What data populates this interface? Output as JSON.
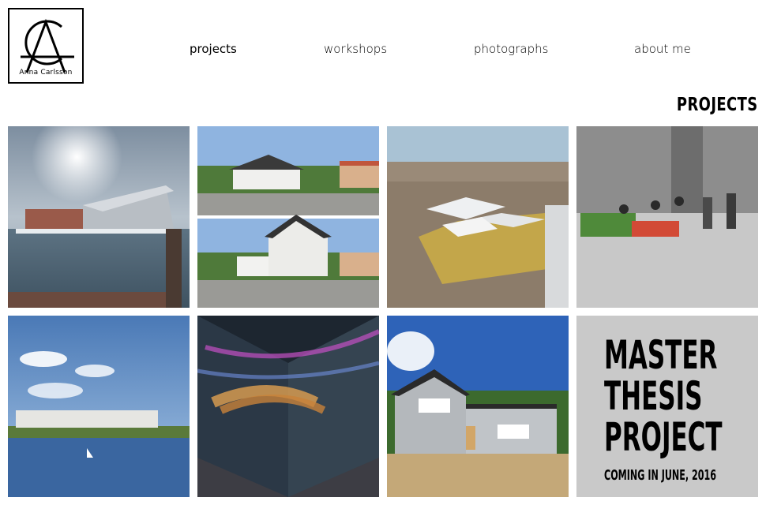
{
  "logo": {
    "monogram": "CA",
    "name": "Anna Carlsson"
  },
  "nav": {
    "items": [
      {
        "label": "projects",
        "active": true
      },
      {
        "label": "workshops",
        "active": false
      },
      {
        "label": "photographs",
        "active": false
      },
      {
        "label": "about me",
        "active": false
      }
    ]
  },
  "page": {
    "title": "PROJECTS"
  },
  "thesis_tile": {
    "line1": "MASTER",
    "line2": "THESIS",
    "line3": "PROJECT",
    "subtitle": "COMING IN JUNE, 2016",
    "background": "#c9c9c9"
  }
}
